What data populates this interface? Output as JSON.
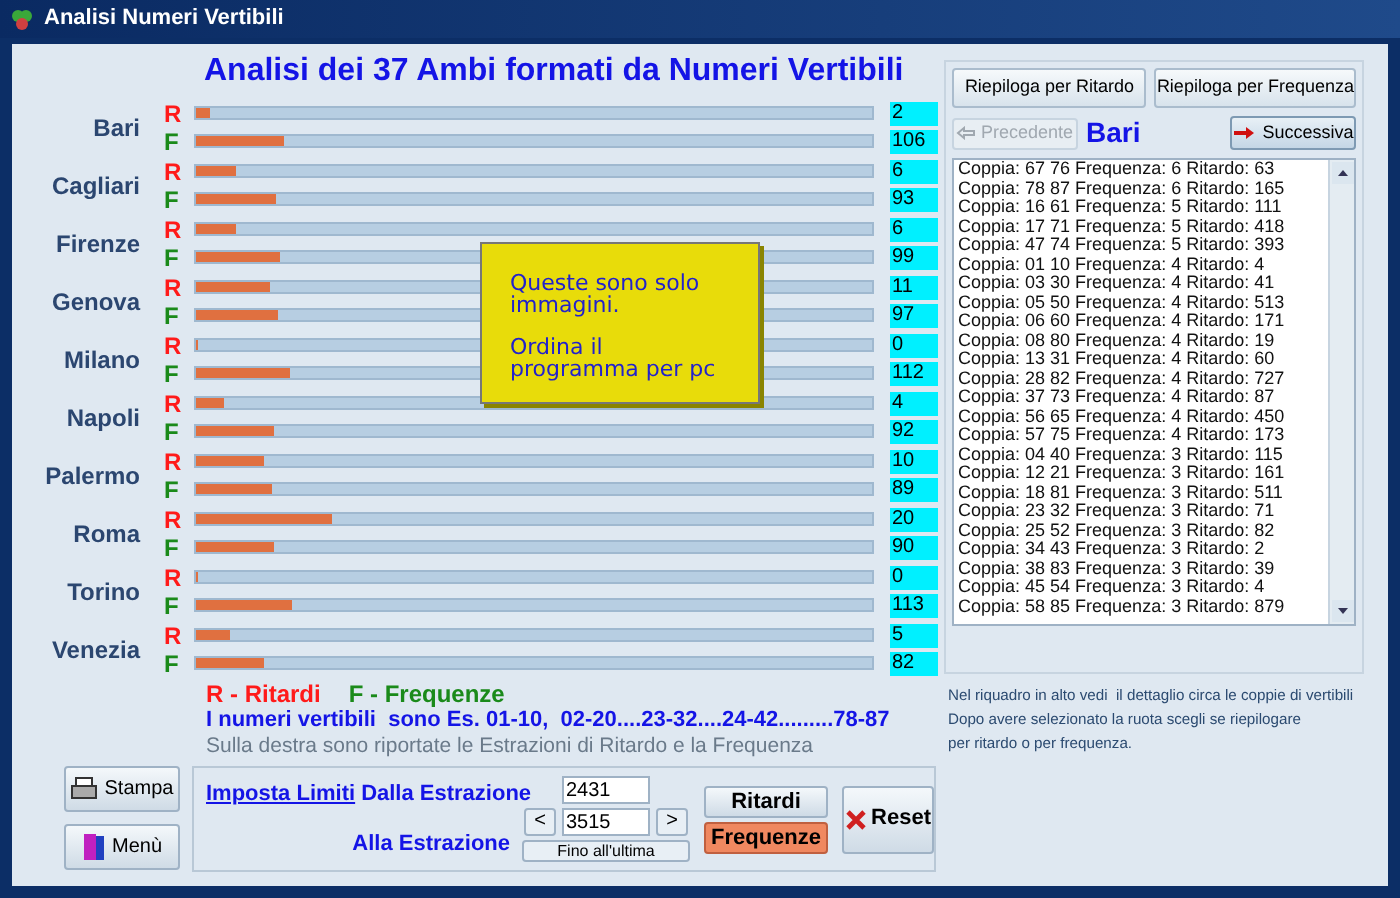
{
  "window": {
    "title": "Analisi Numeri Vertibili"
  },
  "heading": "Analisi dei 37 Ambi formati da Numeri Vertibili",
  "wheels": [
    {
      "name": "Bari",
      "bars": [
        {
          "kind": "ritardo",
          "label": "R",
          "level": 0.02,
          "value": "2"
        },
        {
          "kind": "frequenza",
          "label": "F",
          "level": 0.13,
          "value": "106"
        }
      ]
    },
    {
      "name": "Cagliari",
      "bars": [
        {
          "kind": "ritardo",
          "label": "R",
          "level": 0.06,
          "value": "6"
        },
        {
          "kind": "frequenza",
          "label": "F",
          "level": 0.117,
          "value": "93"
        }
      ]
    },
    {
      "name": "Firenze",
      "bars": [
        {
          "kind": "ritardo",
          "label": "R",
          "level": 0.06,
          "value": "6"
        },
        {
          "kind": "frequenza",
          "label": "F",
          "level": 0.123,
          "value": "99"
        }
      ]
    },
    {
      "name": "Genova",
      "bars": [
        {
          "kind": "ritardo",
          "label": "R",
          "level": 0.11,
          "value": "11"
        },
        {
          "kind": "frequenza",
          "label": "F",
          "level": 0.12,
          "value": "97"
        }
      ]
    },
    {
      "name": "Milano",
      "bars": [
        {
          "kind": "ritardo",
          "label": "R",
          "level": 0,
          "value": "0"
        },
        {
          "kind": "frequenza",
          "label": "F",
          "level": 0.14,
          "value": "112"
        }
      ]
    },
    {
      "name": "Napoli",
      "bars": [
        {
          "kind": "ritardo",
          "label": "R",
          "level": 0.041,
          "value": "4"
        },
        {
          "kind": "frequenza",
          "label": "F",
          "level": 0.114,
          "value": "92"
        }
      ]
    },
    {
      "name": "Palermo",
      "bars": [
        {
          "kind": "ritardo",
          "label": "R",
          "level": 0.1,
          "value": "10"
        },
        {
          "kind": "frequenza",
          "label": "F",
          "level": 0.113,
          "value": "89"
        }
      ]
    },
    {
      "name": "Roma",
      "bars": [
        {
          "kind": "ritardo",
          "label": "R",
          "level": 0.2,
          "value": "20"
        },
        {
          "kind": "frequenza",
          "label": "F",
          "level": 0.114,
          "value": "90"
        }
      ]
    },
    {
      "name": "Torino",
      "bars": [
        {
          "kind": "ritardo",
          "label": "R",
          "level": 0,
          "value": "0"
        },
        {
          "kind": "frequenza",
          "label": "F",
          "level": 0.141,
          "value": "113"
        }
      ]
    },
    {
      "name": "Venezia",
      "bars": [
        {
          "kind": "ritardo",
          "label": "R",
          "level": 0.05,
          "value": "5"
        },
        {
          "kind": "frequenza",
          "label": "F",
          "level": 0.1,
          "value": "82"
        }
      ]
    }
  ],
  "legend": [
    {
      "kind": "ritardo",
      "text": "R - Ritardi"
    },
    {
      "kind": "frequenza",
      "text": "F - Frequenze"
    }
  ],
  "example": "I numeri vertibili  sono Es. 01-10,  02-20....23-32....24-42.........78-87",
  "info": "Sulla destra sono riportate le Estrazioni di Ritardo e la Frequenza",
  "overlay_note": [
    "Queste sono solo immagini.",
    "Ordina il programma per pc"
  ],
  "side_buttons": [
    {
      "kind": "print",
      "label": "Stampa"
    },
    {
      "kind": "menu",
      "label": "Menù"
    }
  ],
  "limits": {
    "link": "Imposta Limiti",
    "from_label": "Dalla Estrazione",
    "from_value": "2431",
    "to_label": "Alla Estrazione",
    "to_value": "3515",
    "prev": "<",
    "next": ">",
    "to_last": "Fino all'ultima"
  },
  "mode_buttons": [
    {
      "label": "Ritardi",
      "selected": false
    },
    {
      "label": "Frequenze",
      "selected": true
    }
  ],
  "reset": "Reset",
  "right": {
    "summary_buttons": [
      "Riepiloga per Ritardo",
      "Riepiloga per Frequenza"
    ],
    "prev": {
      "label": "Precedente",
      "disabled": true
    },
    "wheel": "Bari",
    "next": {
      "label": "Successiva",
      "disabled": false
    },
    "pairs": [
      "Coppia: 67 76 Frequenza: 6 Ritardo: 63",
      "Coppia: 78 87 Frequenza: 6 Ritardo: 165",
      "Coppia: 16 61 Frequenza: 5 Ritardo: 111",
      "Coppia: 17 71 Frequenza: 5 Ritardo: 418",
      "Coppia: 47 74 Frequenza: 5 Ritardo: 393",
      "Coppia: 01 10 Frequenza: 4 Ritardo: 4",
      "Coppia: 03 30 Frequenza: 4 Ritardo: 41",
      "Coppia: 05 50 Frequenza: 4 Ritardo: 513",
      "Coppia: 06 60 Frequenza: 4 Ritardo: 171",
      "Coppia: 08 80 Frequenza: 4 Ritardo: 19",
      "Coppia: 13 31 Frequenza: 4 Ritardo: 60",
      "Coppia: 28 82 Frequenza: 4 Ritardo: 727",
      "Coppia: 37 73 Frequenza: 4 Ritardo: 87",
      "Coppia: 56 65 Frequenza: 4 Ritardo: 450",
      "Coppia: 57 75 Frequenza: 4 Ritardo: 173",
      "Coppia: 04 40 Frequenza: 3 Ritardo: 115",
      "Coppia: 12 21 Frequenza: 3 Ritardo: 161",
      "Coppia: 18 81 Frequenza: 3 Ritardo: 511",
      "Coppia: 23 32 Frequenza: 3 Ritardo: 71",
      "Coppia: 25 52 Frequenza: 3 Ritardo: 82",
      "Coppia: 34 43 Frequenza: 3 Ritardo: 2",
      "Coppia: 38 83 Frequenza: 3 Ritardo: 39",
      "Coppia: 45 54 Frequenza: 3 Ritardo: 4",
      "Coppia: 58 85 Frequenza: 3 Ritardo: 879"
    ],
    "help": [
      "Nel riquadro in alto vedi  il dettaglio circa le coppie di vertibili",
      "Dopo avere selezionato la ruota scegli se riepilogare",
      "per ritardo o per frequenza."
    ]
  }
}
